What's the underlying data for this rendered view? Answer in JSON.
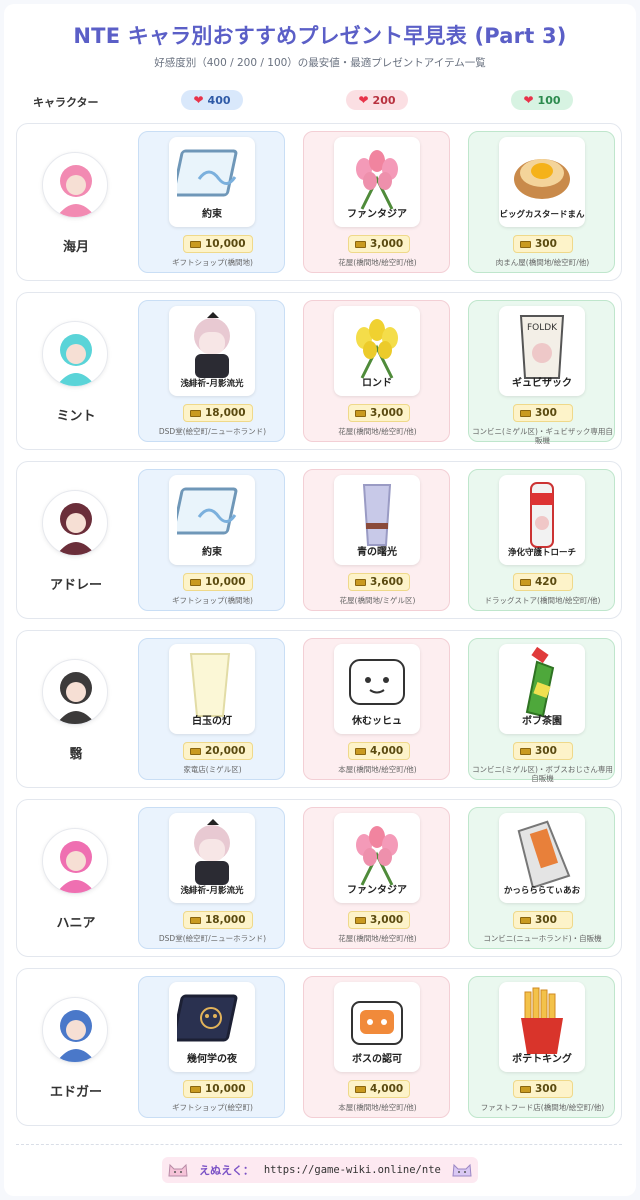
{
  "title": "NTE キャラ別おすすめプレゼント早見表 (Part 3)",
  "subtitle": "好感度別（400 / 200 / 100）の最安値・最適プレゼントアイテム一覧",
  "header": {
    "character_label": "キャラクター",
    "tiers": [
      "400",
      "200",
      "100"
    ]
  },
  "colors": {
    "tier400": "#2e5aa6",
    "tier200": "#b8323f",
    "tier100": "#2b8a4d",
    "title": "#5b5fc7"
  },
  "rows": [
    {
      "character": "海月",
      "items": [
        {
          "name": "約束",
          "price": "10,000",
          "shop": "ギフトショップ(橋間地)",
          "icon": "blue-tile-icon"
        },
        {
          "name": "ファンタジア",
          "price": "3,000",
          "shop": "花屋(橋間地/絵空町/他)",
          "icon": "pink-tulip-icon"
        },
        {
          "name": "ビッグカスタードまん",
          "price": "300",
          "shop": "肉まん屋(橋間地/絵空町/他)",
          "icon": "custard-bun-icon"
        }
      ]
    },
    {
      "character": "ミント",
      "items": [
        {
          "name": "浅緋祈-月影流光",
          "price": "18,000",
          "shop": "DSD堂(絵空町/ニューホランド)",
          "icon": "doll-icon"
        },
        {
          "name": "ロンド",
          "price": "3,000",
          "shop": "花屋(橋間地/絵空町/他)",
          "icon": "yellow-tulip-icon"
        },
        {
          "name": "ギュビザック",
          "price": "300",
          "shop": "コンビニ(ミゲル区)・ギュビザック専用自販機",
          "icon": "snack-bag-icon"
        }
      ]
    },
    {
      "character": "アドレー",
      "items": [
        {
          "name": "約束",
          "price": "10,000",
          "shop": "ギフトショップ(橋間地)",
          "icon": "blue-tile-icon"
        },
        {
          "name": "青の曙光",
          "price": "3,600",
          "shop": "花屋(橋間地/ミゲル区)",
          "icon": "glass-icon"
        },
        {
          "name": "浄化守護トローチ",
          "price": "420",
          "shop": "ドラッグストア(橋間地/絵空町/他)",
          "icon": "lozenge-tube-icon"
        }
      ]
    },
    {
      "character": "翳",
      "items": [
        {
          "name": "白玉の灯",
          "price": "20,000",
          "shop": "家竜店(ミゲル区)",
          "icon": "lamp-icon"
        },
        {
          "name": "休むッヒュ",
          "price": "4,000",
          "shop": "本屋(橋間地/絵空町/他)",
          "icon": "sticker-icon"
        },
        {
          "name": "ボブ茶園",
          "price": "300",
          "shop": "コンビニ(ミゲル区)・ボブスおじさん専用自販機",
          "icon": "tea-bottle-icon"
        }
      ]
    },
    {
      "character": "ハニア",
      "items": [
        {
          "name": "浅緋祈-月影流光",
          "price": "18,000",
          "shop": "DSD堂(絵空町/ニューホランド)",
          "icon": "doll-icon"
        },
        {
          "name": "ファンタジア",
          "price": "3,000",
          "shop": "花屋(橋間地/絵空町/他)",
          "icon": "pink-tulip-icon"
        },
        {
          "name": "かっらららてぃあお",
          "price": "300",
          "shop": "コンビニ(ニューホランド)・自販機",
          "icon": "chips-bag-icon"
        }
      ]
    },
    {
      "character": "エドガー",
      "items": [
        {
          "name": "幾何学の夜",
          "price": "10,000",
          "shop": "ギフトショップ(絵空町)",
          "icon": "dark-tile-icon"
        },
        {
          "name": "ボスの認可",
          "price": "4,000",
          "shop": "本屋(橋間地/絵空町/他)",
          "icon": "boss-sticker-icon"
        },
        {
          "name": "ポテトキング",
          "price": "300",
          "shop": "ファストフード店(橋間地/絵空町/他)",
          "icon": "fries-icon"
        }
      ]
    }
  ],
  "footer": {
    "brand": "えぬえく：",
    "url": "https://game-wiki.online/nte"
  }
}
